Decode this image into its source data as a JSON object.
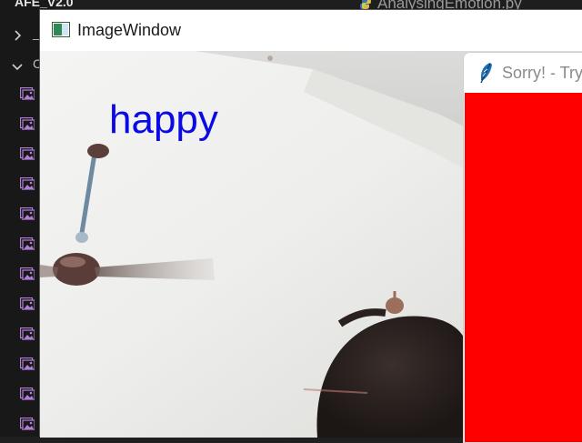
{
  "explorer": {
    "title": "AFE_V2.0",
    "rows": [
      {
        "type": "collapsed-folder",
        "label": "_"
      },
      {
        "type": "expanded-folder",
        "label": "C"
      }
    ],
    "file_count": 12,
    "icon_color": "#b180d7"
  },
  "editor": {
    "tab_label": "AnalysingEmotion.py"
  },
  "image_window": {
    "title": "ImageWindow",
    "emotion_label": "happy",
    "label_color": "#0a0ae6"
  },
  "sorry_window": {
    "title": "Sorry! - Try",
    "content_color": "#ff0000"
  }
}
